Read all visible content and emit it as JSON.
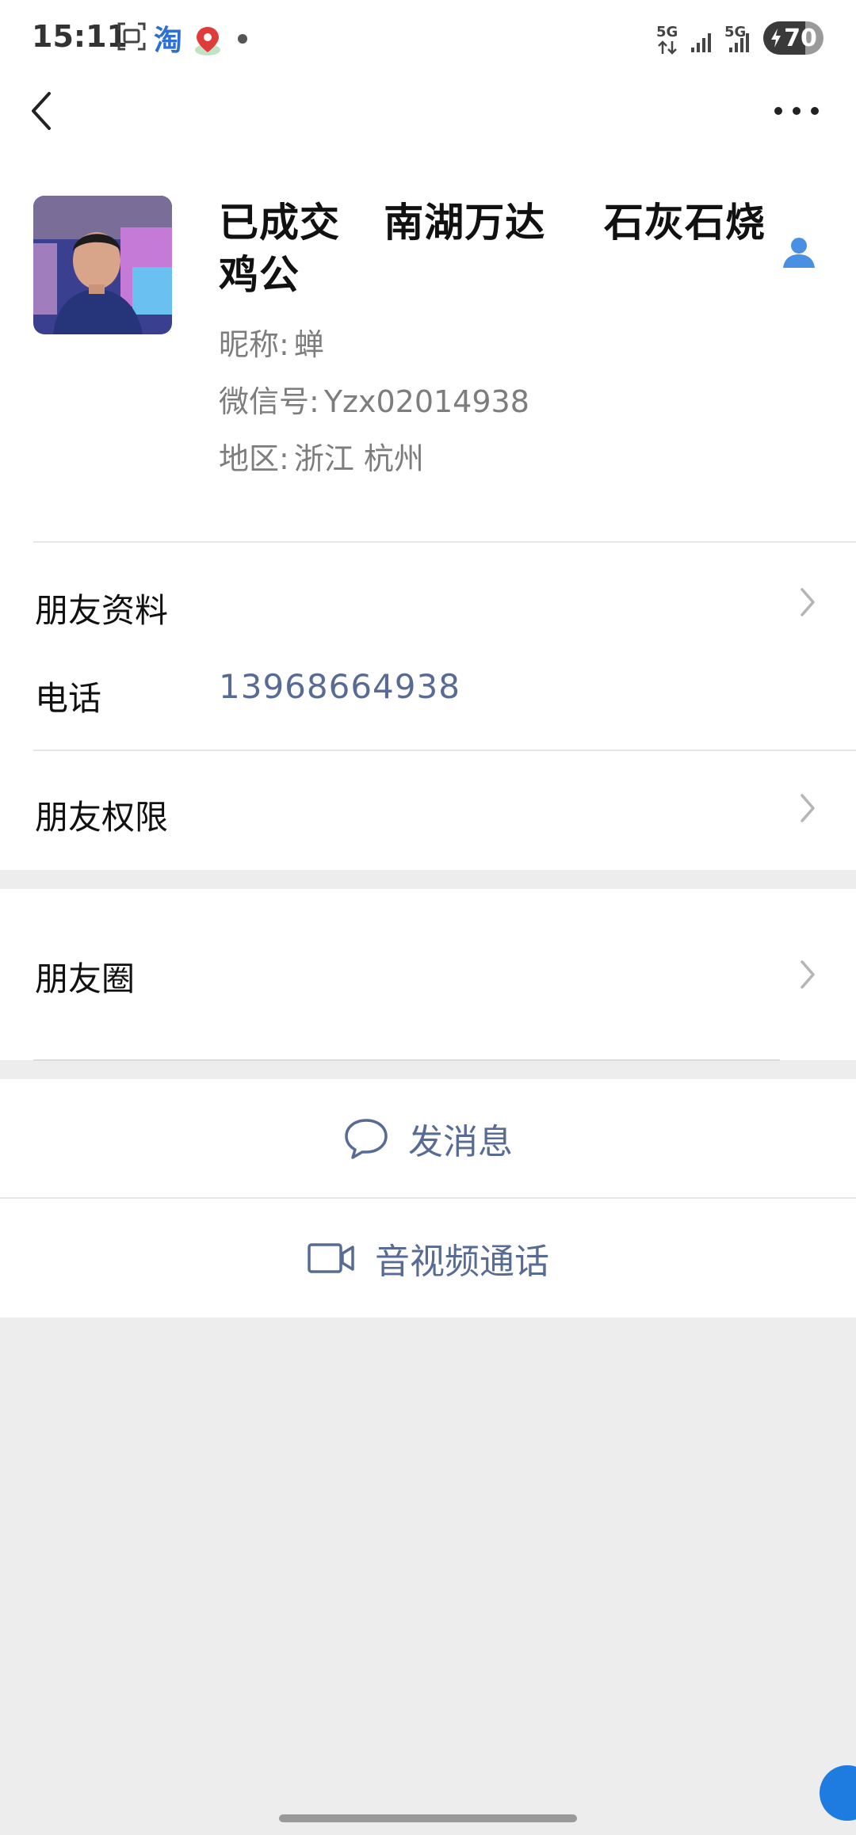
{
  "status_bar": {
    "time": "15:11",
    "app_glyph": "淘",
    "signal1_label": "5G",
    "signal2_label": "5G",
    "battery_level": "70",
    "battery_fraction": 0.7
  },
  "nav": {
    "back_icon": "chevron-left-icon",
    "more_icon": "more-dots-icon"
  },
  "profile": {
    "name": "已成交   南湖万达    石灰石烧鸡公",
    "nickname_label": "昵称:",
    "nickname_value": "蝉",
    "wechat_id_label": "微信号:",
    "wechat_id_value": "Yzx02014938",
    "region_label": "地区:",
    "region_value": "浙江  杭州",
    "contact_icon": "contact-person-icon"
  },
  "rows": {
    "friend_info": "朋友资料",
    "phone_label": "电话",
    "phone_value": "13968664938",
    "friend_permissions": "朋友权限",
    "moments": "朋友圈"
  },
  "actions": {
    "send_message": "发消息",
    "video_call": "音视频通话"
  },
  "colors": {
    "link_blue": "#576b95",
    "background_gray": "#ededed",
    "contact_icon_blue": "#4a90e2"
  }
}
